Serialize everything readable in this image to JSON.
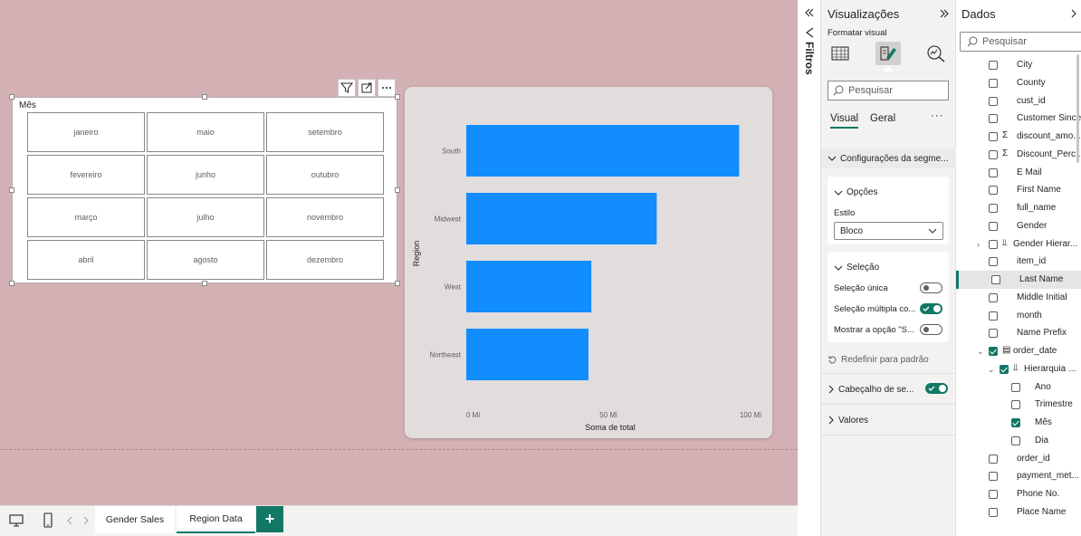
{
  "slicer": {
    "title": "Mês",
    "months": [
      "janeiro",
      "maio",
      "setembro",
      "fevereiro",
      "junho",
      "outubro",
      "março",
      "julho",
      "novembro",
      "abril",
      "agosto",
      "dezembro"
    ]
  },
  "chart_data": {
    "type": "bar",
    "orientation": "horizontal",
    "categories": [
      "South",
      "Midwest",
      "West",
      "Northeast"
    ],
    "values": [
      96,
      67,
      44,
      43
    ],
    "value_unit": "Mi",
    "xlim": [
      0,
      100
    ],
    "xticks": [
      "0 Mi",
      "50 Mi",
      "100 Mi"
    ],
    "xlabel": "Soma de total",
    "ylabel": "Region",
    "bar_color": "#118dff",
    "grid": false
  },
  "tabs": {
    "pages": [
      "Gender Sales",
      "Region Data"
    ],
    "active": "Region Data",
    "add_label": "+"
  },
  "filters": {
    "label": "Filtros"
  },
  "viz_pane": {
    "title": "Visualizações",
    "subtitle": "Formatar visual",
    "search_placeholder": "Pesquisar",
    "tab_visual": "Visual",
    "tab_geral": "Geral",
    "section_config": "Configurações da segme...",
    "opcoes": "Opções",
    "estilo_label": "Estilo",
    "estilo_value": "Bloco",
    "selecao": "Seleção",
    "selecao_unica": "Seleção única",
    "selecao_multipla": "Seleção múltipla co...",
    "mostrar_opcao": "Mostrar a opção \"S...",
    "reset": "Redefinir para padrão",
    "cabecalho": "Cabeçalho de se...",
    "valores": "Valores",
    "accent_color": "#117865"
  },
  "data_pane": {
    "title": "Dados",
    "search_placeholder": "Pesquisar",
    "fields": [
      {
        "label": "City",
        "checked": false,
        "indent": 0
      },
      {
        "label": "County",
        "checked": false,
        "indent": 0
      },
      {
        "label": "cust_id",
        "checked": false,
        "indent": 0
      },
      {
        "label": "Customer Since",
        "checked": false,
        "indent": 0
      },
      {
        "label": "discount_amo...",
        "checked": false,
        "indent": 0,
        "sigma": true
      },
      {
        "label": "Discount_Perc...",
        "checked": false,
        "indent": 0,
        "sigma": true
      },
      {
        "label": "E Mail",
        "checked": false,
        "indent": 0
      },
      {
        "label": "First Name",
        "checked": false,
        "indent": 0
      },
      {
        "label": "full_name",
        "checked": false,
        "indent": 0
      },
      {
        "label": "Gender",
        "checked": false,
        "indent": 0
      },
      {
        "label": "Gender Hierar...",
        "checked": false,
        "indent": 0,
        "hier": true
      },
      {
        "label": "item_id",
        "checked": false,
        "indent": 0
      },
      {
        "label": "Last Name",
        "checked": false,
        "indent": 0,
        "selected": true
      },
      {
        "label": "Middle Initial",
        "checked": false,
        "indent": 0
      },
      {
        "label": "month",
        "checked": false,
        "indent": 0
      },
      {
        "label": "Name Prefix",
        "checked": false,
        "indent": 0
      },
      {
        "label": "order_date",
        "checked": true,
        "indent": 0,
        "date": true
      },
      {
        "label": "Hierarquia ...",
        "checked": true,
        "indent": 1,
        "hier": true
      },
      {
        "label": "Ano",
        "checked": false,
        "indent": 2
      },
      {
        "label": "Trimestre",
        "checked": false,
        "indent": 2
      },
      {
        "label": "Mês",
        "checked": true,
        "indent": 2
      },
      {
        "label": "Dia",
        "checked": false,
        "indent": 2
      },
      {
        "label": "order_id",
        "checked": false,
        "indent": 0
      },
      {
        "label": "payment_met...",
        "checked": false,
        "indent": 0
      },
      {
        "label": "Phone No.",
        "checked": false,
        "indent": 0
      },
      {
        "label": "Place Name",
        "checked": false,
        "indent": 0
      }
    ]
  }
}
